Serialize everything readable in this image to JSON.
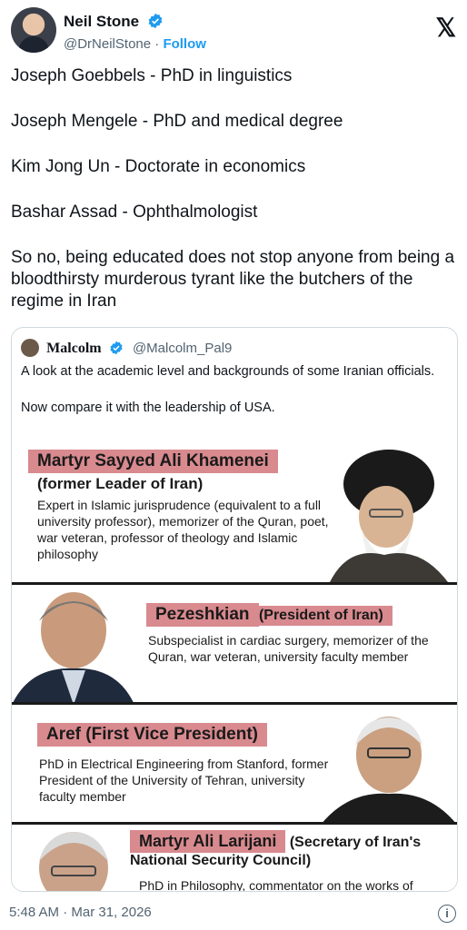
{
  "author": {
    "name": "Neil Stone",
    "handle": "@DrNeilStone",
    "separator": "·",
    "follow_label": "Follow"
  },
  "post": {
    "lines": [
      "Joseph Goebbels - PhD in linguistics",
      "Joseph Mengele - PhD and medical degree",
      "Kim Jong Un - Doctorate in economics",
      "Bashar Assad - Ophthalmologist",
      "So no, being educated does not stop anyone from being a bloodthirsty murderous tyrant like the butchers of the regime in Iran"
    ]
  },
  "quoted": {
    "name": "Malcolm",
    "handle": "@Malcolm_Pal9",
    "text1": "A look at the academic level and backgrounds of some Iranian officials.",
    "text2": "Now compare it with the leadership of USA.",
    "panels": [
      {
        "title": "Martyr Sayyed Ali Khamenei",
        "subtitle": "(former Leader of Iran)",
        "desc": "Expert in Islamic jurisprudence (equivalent to a full university professor), memorizer of the Quran, poet, war veteran, professor of theology and Islamic philosophy"
      },
      {
        "title": "Pezeshkian",
        "title_suffix": "(President of Iran)",
        "desc": "Subspecialist in cardiac surgery, memorizer of the Quran, war veteran, university faculty member"
      },
      {
        "title": "Aref (First Vice President)",
        "desc": "PhD in Electrical Engineering from Stanford, former President of the University of Tehran, university faculty member"
      },
      {
        "title": "Martyr Ali Larijani",
        "title_suffix": "(Secretary of Iran's National Security Council)",
        "desc": "PhD in Philosophy, commentator on the works of"
      }
    ]
  },
  "timestamp": "5:48 AM · Mar 31, 2026",
  "colors": {
    "accent": "#1d9bf0",
    "panel_title_bg": "#d88a8f"
  },
  "icons": {
    "verified": "verified-badge-icon",
    "x_logo": "x-logo-icon",
    "info": "info-icon"
  }
}
